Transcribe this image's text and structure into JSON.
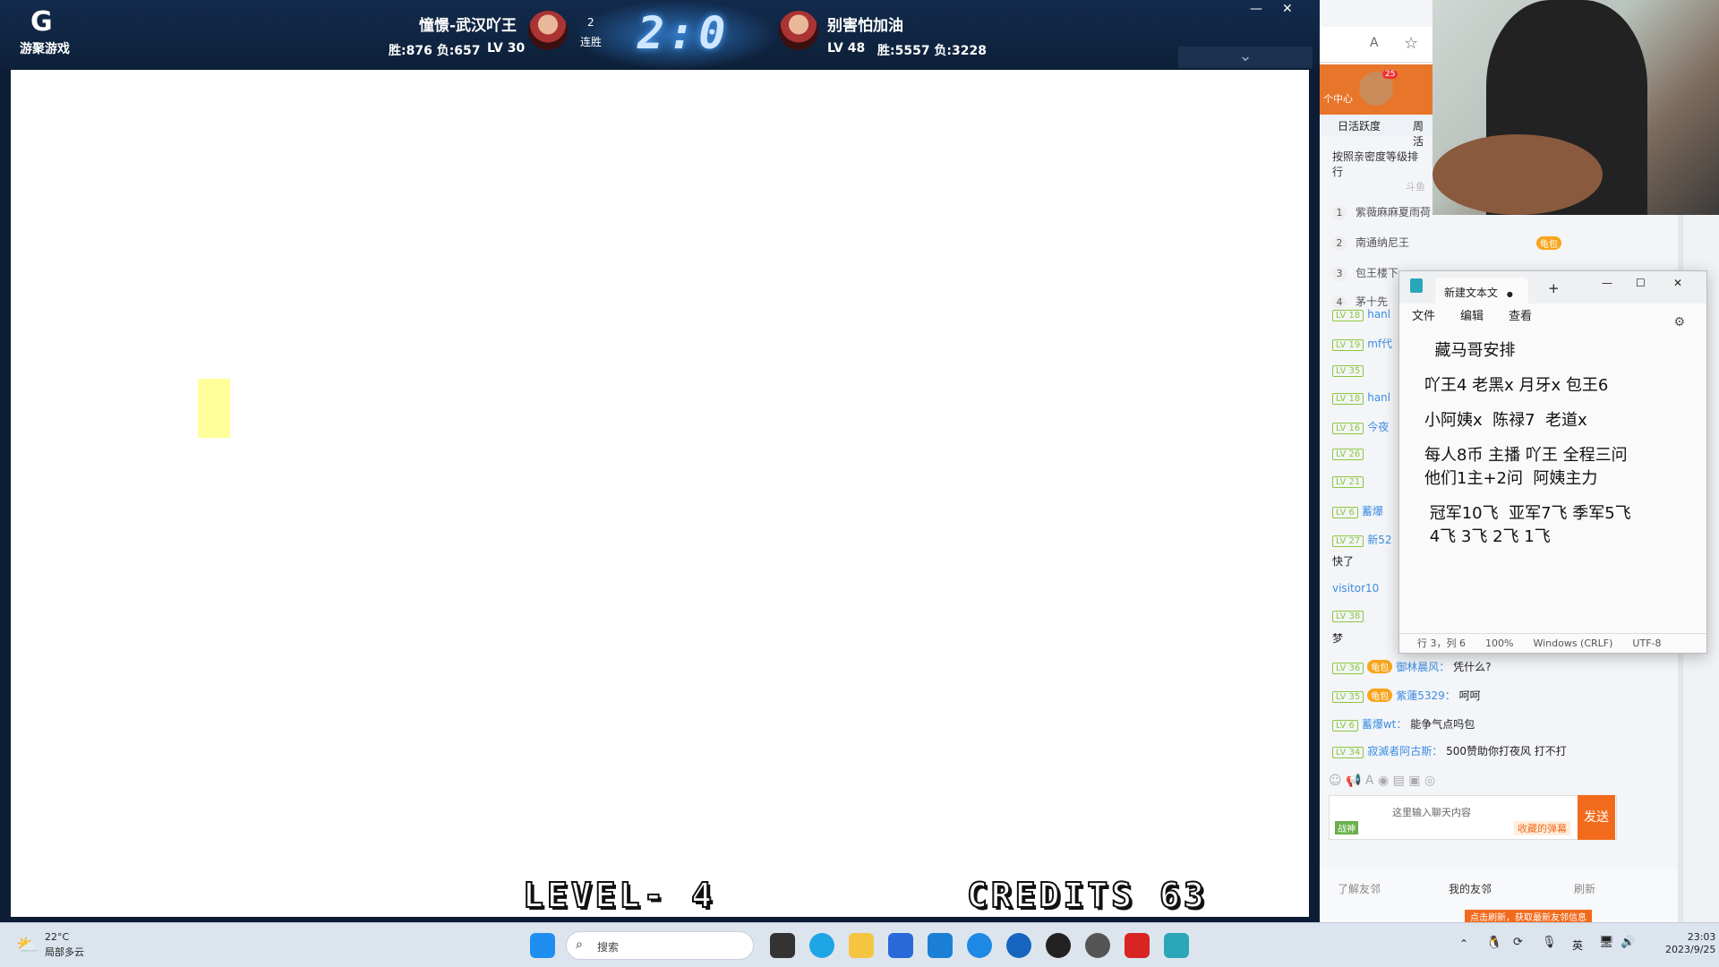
{
  "game": {
    "logo_text": "游聚游戏",
    "logo_glyph": "G",
    "player1": {
      "name": "憧憬-武汉吖王",
      "wins": "胜:876 负:657",
      "level": "LV 30"
    },
    "player2": {
      "name": "别害怕加油",
      "wins": "胜:5557 负:3228",
      "level": "LV 48"
    },
    "streak_count": "2",
    "streak_label": "连胜",
    "score": "2:0",
    "minimize": "—",
    "close": "✕",
    "collapse": "⌄",
    "level_text": "LEVEL- 4",
    "credits_text": "CREDITS 63"
  },
  "panel": {
    "font_icon": "A",
    "star_icon": "☆",
    "user_center": "个中心",
    "badge_count": "25",
    "tabs": [
      "日活跃度",
      "周活"
    ],
    "rank_title": "按照亲密度等级排行",
    "rank_subtitle": "斗鱼",
    "ranks": [
      {
        "n": "1",
        "name": "紫薇麻麻夏雨荷"
      },
      {
        "n": "2",
        "name": "南通纳尼王"
      },
      {
        "n": "3",
        "name": "包王楼下"
      },
      {
        "n": "4",
        "name": "茅十先"
      }
    ],
    "rank_badge": "龟包",
    "chat": [
      {
        "lv": "LV 18",
        "user": "hanl",
        "msg": ""
      },
      {
        "lv": "LV 19",
        "user": "mf代",
        "msg": ""
      },
      {
        "lv": "LV 35",
        "user": "",
        "msg": ""
      },
      {
        "lv": "LV 18",
        "user": "hanl",
        "msg": ""
      },
      {
        "lv": "LV 16",
        "user": "今夜",
        "msg": ""
      },
      {
        "lv": "LV 26",
        "user": "",
        "msg": ""
      },
      {
        "lv": "LV 21",
        "user": "",
        "msg": ""
      },
      {
        "lv": "LV 6",
        "user": "蓄爆",
        "msg": ""
      },
      {
        "lv": "LV 27",
        "user": "新52",
        "msg": ""
      }
    ],
    "chat_plain_1": "快了",
    "chat_visitor": "visitor10",
    "chat_lv38": "LV 38",
    "chat_plain_2": "梦",
    "chat_bottom": [
      {
        "lv": "LV 36",
        "badge": "龟包",
        "user": "御林晨风：",
        "msg": "凭什么?"
      },
      {
        "lv": "LV 35",
        "badge": "龟包",
        "user": "紫蓮5329：",
        "msg": "呵呵"
      },
      {
        "lv": "LV 6",
        "badge": "",
        "user": "蓄爆wt：",
        "msg": "能争气点吗包"
      },
      {
        "lv": "LV 34",
        "badge": "",
        "user": "寂滅者阿古斯：",
        "msg": "500赞助你打夜风 打不打"
      }
    ],
    "input_placeholder": "这里输入聊天内容",
    "input_hint": "收藏的弹幕",
    "send": "发送",
    "war_god": "战神",
    "friends_label": "了解友邻",
    "my_friends": "我的友邻",
    "refresh": "刷新",
    "promo": "点击刷新，获取最新友邻信息"
  },
  "notepad": {
    "tab_title": "新建文本文",
    "dot": "●",
    "plus": "+",
    "menu": [
      "文件",
      "编辑",
      "查看"
    ],
    "lines": [
      "  藏马哥安排",
      "",
      "吖王4 老黑x 月牙x 包王6",
      "",
      "小阿姨x  陈禄7  老道x",
      "",
      "每人8币 主播 吖王 全程三问",
      "他们1主+2问  阿姨主力",
      "",
      " 冠军10飞  亚军7飞 季军5飞",
      " 4飞 3飞 2飞 1飞"
    ],
    "status": [
      "行 3，列 6",
      "100%",
      "Windows (CRLF)",
      "UTF-8"
    ],
    "min": "—",
    "max": "☐",
    "close": "✕"
  },
  "taskbar": {
    "weather_temp": "22°C",
    "weather_desc": "局部多云",
    "search": "搜索",
    "lang": "英",
    "time": "23:03",
    "date": "2023/9/25"
  }
}
